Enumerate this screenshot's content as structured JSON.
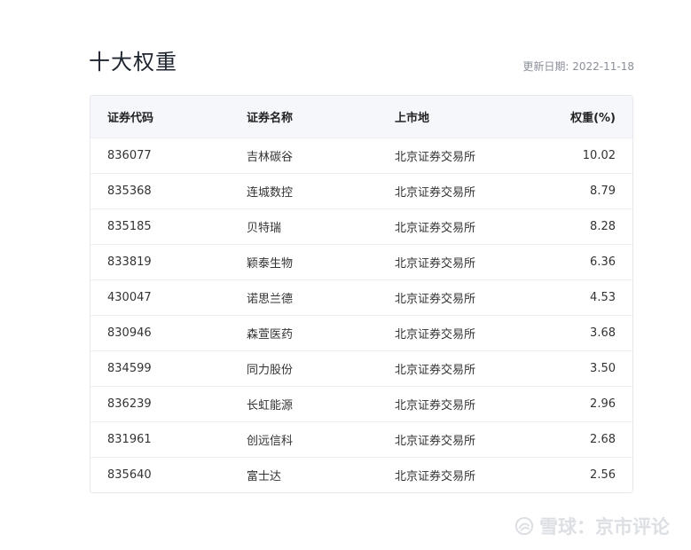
{
  "page": {
    "title": "十大权重",
    "update_label": "更新日期:",
    "update_date": "2022-11-18"
  },
  "table": {
    "headers": [
      "证券代码",
      "证券名称",
      "上市地",
      "权重(%)"
    ],
    "rows": [
      [
        "836077",
        "吉林碳谷",
        "北京证券交易所",
        "10.02"
      ],
      [
        "835368",
        "连城数控",
        "北京证券交易所",
        "8.79"
      ],
      [
        "835185",
        "贝特瑞",
        "北京证券交易所",
        "8.28"
      ],
      [
        "833819",
        "颖泰生物",
        "北京证券交易所",
        "6.36"
      ],
      [
        "430047",
        "诺思兰德",
        "北京证券交易所",
        "4.53"
      ],
      [
        "830946",
        "森萱医药",
        "北京证券交易所",
        "3.68"
      ],
      [
        "834599",
        "同力股份",
        "北京证券交易所",
        "3.50"
      ],
      [
        "836239",
        "长虹能源",
        "北京证券交易所",
        "2.96"
      ],
      [
        "831961",
        "创远信科",
        "北京证券交易所",
        "2.68"
      ],
      [
        "835640",
        "富士达",
        "北京证券交易所",
        "2.56"
      ]
    ]
  },
  "watermark": {
    "text": "雪球：京市评论",
    "logo_icon": "snowball-logo-icon"
  }
}
